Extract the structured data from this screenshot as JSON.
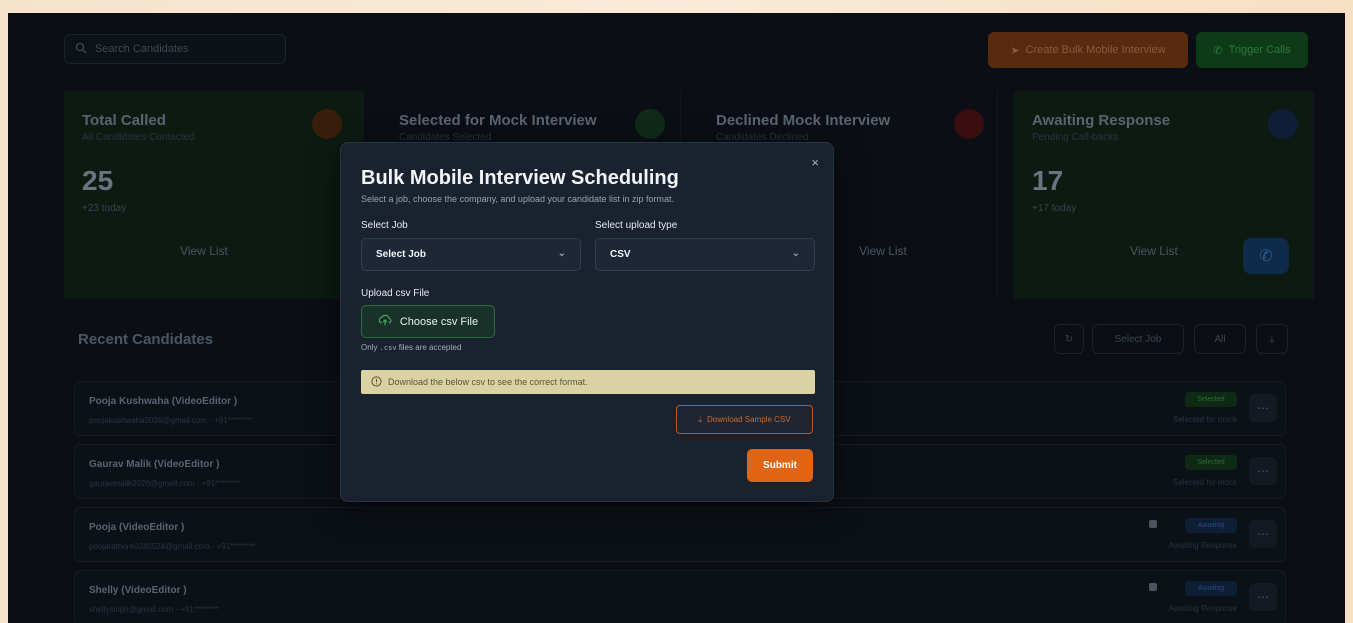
{
  "header": {
    "search_placeholder": "Search Candidates",
    "bulk_button": "Create Bulk Mobile Interview",
    "trigger_button": "Trigger Calls"
  },
  "stats": [
    {
      "title": "Total Called",
      "subtitle": "All Candidates Contacted",
      "count": "25",
      "today": "+23 today",
      "view": "View List"
    },
    {
      "title": "Selected for Mock Interview",
      "subtitle": "Candidates Selected",
      "count": "",
      "today": "",
      "view": ""
    },
    {
      "title": "Declined Mock Interview",
      "subtitle": "Candidates Declined",
      "count": "",
      "today": "",
      "view": "View List"
    },
    {
      "title": "Awaiting Response",
      "subtitle": "Pending Call-backs",
      "count": "17",
      "today": "+17 today",
      "view": "View List"
    }
  ],
  "recent": {
    "title": "Recent Candidates",
    "select_job": "Select Job",
    "all": "All",
    "rows": [
      {
        "name": "Pooja Kushwaha  (VideoEditor )",
        "meta": "poojakushwaha2026@gmail.com  ·  +91********",
        "badge": "Selected",
        "status": "Selected for mock"
      },
      {
        "name": "Gaurav Malik  (VideoEditor )",
        "meta": "gauravmalik2026@gmail.com  ·  +91********",
        "badge": "Selected",
        "status": "Selected for mock"
      },
      {
        "name": "Pooja  (VideoEditor )",
        "meta": "poojarathore0240524@gmail.com  ·  +91********",
        "badge": "Awaiting",
        "status": "Awaiting Response"
      },
      {
        "name": "Shelly  (VideoEditor )",
        "meta": "shellysingh@gmail.com  ·  +91********",
        "badge": "Awaiting",
        "status": "Awaiting Response"
      }
    ]
  },
  "modal": {
    "title": "Bulk Mobile Interview Scheduling",
    "subtitle": "Select a job, choose the company, and upload your candidate list in zip format.",
    "select_job_label": "Select Job",
    "select_job_value": "Select Job",
    "upload_type_label": "Select upload type",
    "upload_type_value": "CSV",
    "upload_label": "Upload csv File",
    "choose_button": "Choose csv File",
    "accept_prefix": "Only ",
    "accept_code": ".csv",
    "accept_suffix": " files are accepted",
    "notice": "Download the below csv to see the correct format.",
    "download_button": "Download Sample CSV",
    "submit_button": "Submit",
    "close": "×"
  },
  "colors": {
    "accent_orange": "#e06414",
    "accent_green": "#2f6b3e",
    "modal_bg": "#1a2230",
    "notice_bg": "#d9d3a4"
  }
}
